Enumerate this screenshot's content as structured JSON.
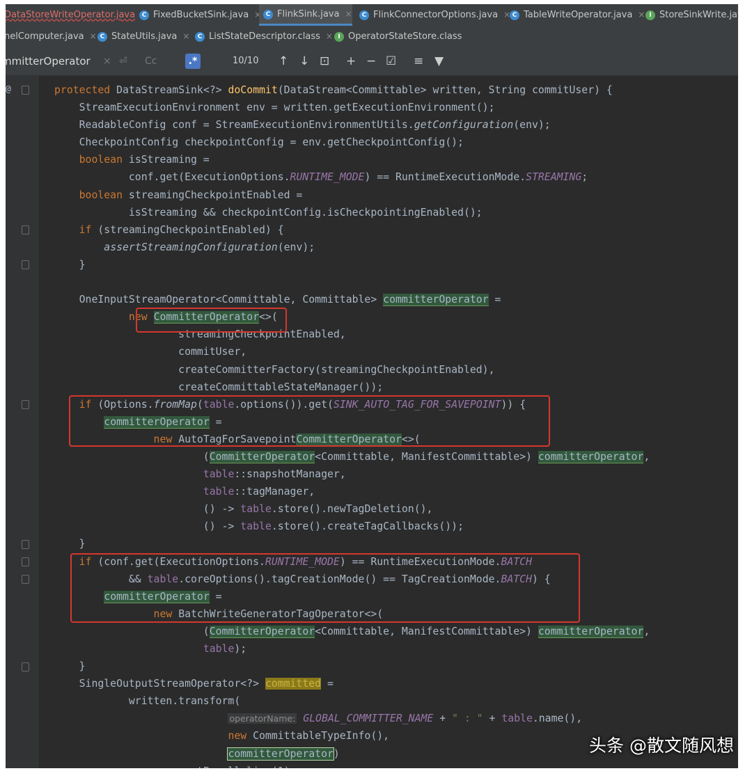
{
  "tabs_row1": [
    {
      "label": "DataStoreWriteOperator.java",
      "icon": "c-class-icon"
    },
    {
      "label": "FixedBucketSink.java",
      "icon": "c-class-icon"
    },
    {
      "label": "FlinkSink.java",
      "icon": "c-class-icon",
      "active": true
    },
    {
      "label": "FlinkConnectorOptions.java",
      "icon": "c-class-icon"
    },
    {
      "label": "TableWriteOperator.java",
      "icon": "c-class-icon"
    },
    {
      "label": "StoreSinkWrite.java",
      "icon": "i-interface-icon"
    }
  ],
  "tabs_row2": [
    {
      "label": "nelComputer.java"
    },
    {
      "label": "StateUtils.java",
      "icon": "c-class-icon"
    },
    {
      "label": "ListStateDescriptor.class",
      "icon": "c-class-icon"
    },
    {
      "label": "OperatorStateStore.class",
      "icon": "i-interface-icon"
    }
  ],
  "find": {
    "query": "mmitterOperator",
    "close": "×",
    "count": "10/10"
  },
  "code_tokens": {
    "protected": "protected",
    "return_type": "DataStreamSink<?>",
    "method": "doCommit",
    "params": "(DataStream<Committable> written, String commitUser) {",
    "new": "new",
    "if": "if",
    "boolean": "boolean",
    "committerOperator": "committerOperator",
    "CommitterOperator": "CommitterOperator",
    "committed": "committed",
    "RUNTIME_MODE": "RUNTIME_MODE",
    "STREAMING": "STREAMING",
    "BATCH": "BATCH",
    "SINK_AUTO_TAG_FOR_SAVEPOINT": "SINK_AUTO_TAG_FOR_SAVEPOINT",
    "GLOBAL_COMMITTER_NAME": "GLOBAL_COMMITTER_NAME",
    "table": "table",
    "fromMap": "fromMap",
    "getConfiguration": "getConfiguration",
    "assertStreamingConfiguration": "assertStreamingConfiguration",
    "hint_operatorName": "operatorName:",
    "str_colon": "\" : \""
  },
  "watermark": "头条 @散文随风想"
}
